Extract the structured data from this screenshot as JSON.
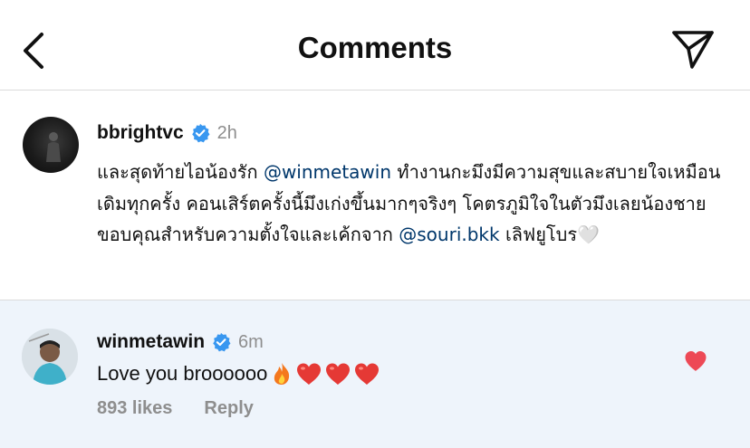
{
  "header": {
    "title": "Comments",
    "icons": {
      "back": "chevron-left-icon",
      "send": "paper-plane-icon"
    }
  },
  "post": {
    "username": "bbrightvc",
    "time": "2h",
    "caption_parts": {
      "p1": "และสุดท้ายไอน้องรัก ",
      "mention1": "@winmetawin",
      "p2": " ทำงานกะมึงมีความสุขและสบายใจเหมือนเดิมทุกครั้ง คอนเสิร์ตครั้งนี้มึงเก่งขึ้นมากๆจริงๆ โคตรภูมิใจในตัวมึงเลยน้องชาย ขอบคุณสำหรับความตั้งใจและเค้กจาก ",
      "mention2": "@souri.bkk",
      "p3": " เลิฟยูโบร",
      "emoji": "🤍"
    }
  },
  "comment": {
    "username": "winmetawin",
    "time": "6m",
    "text": "Love you broooooo",
    "emojis": [
      "🔥",
      "❤️",
      "❤️",
      "❤️"
    ],
    "likes": "893 likes",
    "reply_label": "Reply",
    "liked": true
  },
  "colors": {
    "verified": "#3897f0",
    "mention": "#00376b",
    "muted": "#8e8e8e",
    "heart": "#ed4956",
    "highlight_bg": "#eef4fb",
    "divider": "#dbdbdb"
  }
}
